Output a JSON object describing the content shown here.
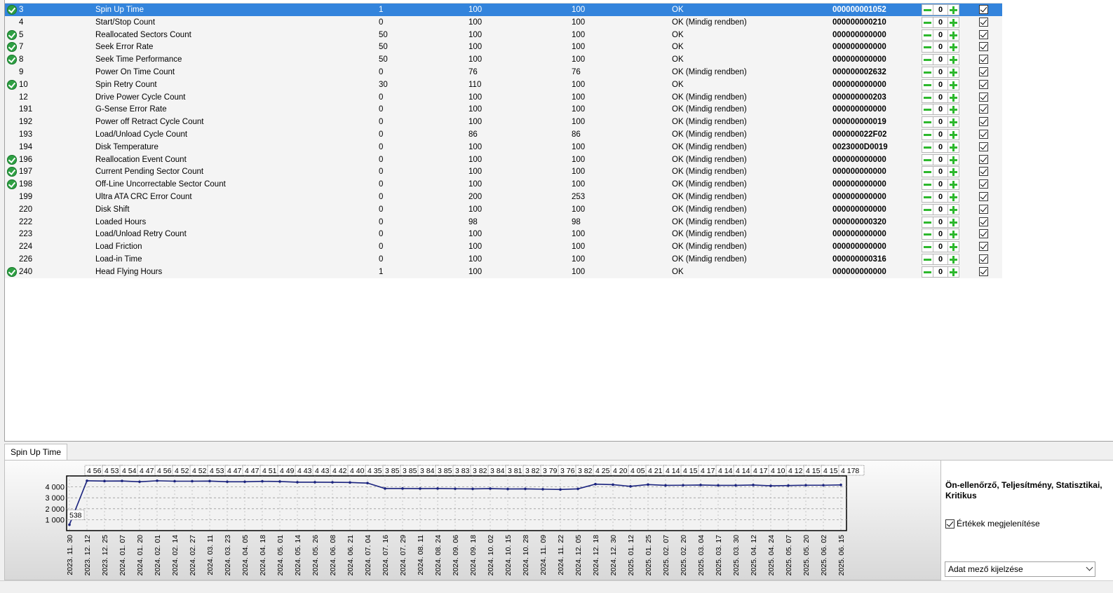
{
  "table": {
    "rows": [
      {
        "id": "3",
        "name": "Spin Up Time",
        "threshold": "1",
        "value": "100",
        "worst": "100",
        "status": "OK",
        "raw": "000000001052",
        "critical": true,
        "selected": true,
        "stepper": "0"
      },
      {
        "id": "4",
        "name": "Start/Stop Count",
        "threshold": "0",
        "value": "100",
        "worst": "100",
        "status": "OK (Mindig rendben)",
        "raw": "000000000210",
        "critical": false,
        "stepper": "0"
      },
      {
        "id": "5",
        "name": "Reallocated Sectors Count",
        "threshold": "50",
        "value": "100",
        "worst": "100",
        "status": "OK",
        "raw": "000000000000",
        "critical": true,
        "stepper": "0"
      },
      {
        "id": "7",
        "name": "Seek Error Rate",
        "threshold": "50",
        "value": "100",
        "worst": "100",
        "status": "OK",
        "raw": "000000000000",
        "critical": true,
        "stepper": "0"
      },
      {
        "id": "8",
        "name": "Seek Time Performance",
        "threshold": "50",
        "value": "100",
        "worst": "100",
        "status": "OK",
        "raw": "000000000000",
        "critical": true,
        "stepper": "0"
      },
      {
        "id": "9",
        "name": "Power On Time Count",
        "threshold": "0",
        "value": "76",
        "worst": "76",
        "status": "OK (Mindig rendben)",
        "raw": "000000002632",
        "critical": false,
        "stepper": "0"
      },
      {
        "id": "10",
        "name": "Spin Retry Count",
        "threshold": "30",
        "value": "110",
        "worst": "100",
        "status": "OK",
        "raw": "000000000000",
        "critical": true,
        "stepper": "0"
      },
      {
        "id": "12",
        "name": "Drive Power Cycle Count",
        "threshold": "0",
        "value": "100",
        "worst": "100",
        "status": "OK (Mindig rendben)",
        "raw": "000000000203",
        "critical": false,
        "stepper": "0"
      },
      {
        "id": "191",
        "name": "G-Sense Error Rate",
        "threshold": "0",
        "value": "100",
        "worst": "100",
        "status": "OK (Mindig rendben)",
        "raw": "000000000000",
        "critical": false,
        "stepper": "0"
      },
      {
        "id": "192",
        "name": "Power off Retract Cycle Count",
        "threshold": "0",
        "value": "100",
        "worst": "100",
        "status": "OK (Mindig rendben)",
        "raw": "000000000019",
        "critical": false,
        "stepper": "0"
      },
      {
        "id": "193",
        "name": "Load/Unload Cycle Count",
        "threshold": "0",
        "value": "86",
        "worst": "86",
        "status": "OK (Mindig rendben)",
        "raw": "000000022F02",
        "critical": false,
        "stepper": "0"
      },
      {
        "id": "194",
        "name": "Disk Temperature",
        "threshold": "0",
        "value": "100",
        "worst": "100",
        "status": "OK (Mindig rendben)",
        "raw": "0023000D0019",
        "critical": false,
        "stepper": "0"
      },
      {
        "id": "196",
        "name": "Reallocation Event Count",
        "threshold": "0",
        "value": "100",
        "worst": "100",
        "status": "OK (Mindig rendben)",
        "raw": "000000000000",
        "critical": true,
        "stepper": "0"
      },
      {
        "id": "197",
        "name": "Current Pending Sector Count",
        "threshold": "0",
        "value": "100",
        "worst": "100",
        "status": "OK (Mindig rendben)",
        "raw": "000000000000",
        "critical": true,
        "stepper": "0"
      },
      {
        "id": "198",
        "name": "Off-Line Uncorrectable Sector Count",
        "threshold": "0",
        "value": "100",
        "worst": "100",
        "status": "OK (Mindig rendben)",
        "raw": "000000000000",
        "critical": true,
        "stepper": "0"
      },
      {
        "id": "199",
        "name": "Ultra ATA CRC Error Count",
        "threshold": "0",
        "value": "200",
        "worst": "253",
        "status": "OK (Mindig rendben)",
        "raw": "000000000000",
        "critical": false,
        "stepper": "0"
      },
      {
        "id": "220",
        "name": "Disk Shift",
        "threshold": "0",
        "value": "100",
        "worst": "100",
        "status": "OK (Mindig rendben)",
        "raw": "000000000000",
        "critical": false,
        "stepper": "0"
      },
      {
        "id": "222",
        "name": "Loaded Hours",
        "threshold": "0",
        "value": "98",
        "worst": "98",
        "status": "OK (Mindig rendben)",
        "raw": "000000000320",
        "critical": false,
        "stepper": "0"
      },
      {
        "id": "223",
        "name": "Load/Unload Retry Count",
        "threshold": "0",
        "value": "100",
        "worst": "100",
        "status": "OK (Mindig rendben)",
        "raw": "000000000000",
        "critical": false,
        "stepper": "0"
      },
      {
        "id": "224",
        "name": "Load Friction",
        "threshold": "0",
        "value": "100",
        "worst": "100",
        "status": "OK (Mindig rendben)",
        "raw": "000000000000",
        "critical": false,
        "stepper": "0"
      },
      {
        "id": "226",
        "name": "Load-in Time",
        "threshold": "0",
        "value": "100",
        "worst": "100",
        "status": "OK (Mindig rendben)",
        "raw": "000000000316",
        "critical": false,
        "stepper": "0"
      },
      {
        "id": "240",
        "name": "Head Flying Hours",
        "threshold": "1",
        "value": "100",
        "worst": "100",
        "status": "OK",
        "raw": "000000000000",
        "critical": true,
        "stepper": "0"
      }
    ]
  },
  "tabs": [
    {
      "label": "Spin Up Time",
      "active": true
    }
  ],
  "side_panel": {
    "title": "Ön-ellenőrző, Teljesítmény, Statisztikai, Kritikus",
    "show_values_label": "Értékek megjelenítése",
    "show_values_checked": true,
    "select_value": "Adat mező kijelzése"
  },
  "colors": {
    "selection": "#3384dc",
    "ok_green": "#2ea043",
    "line": "#1a237e"
  },
  "chart_data": {
    "type": "line",
    "title": "",
    "xlabel": "",
    "ylabel": "",
    "ylim": [
      0,
      5000
    ],
    "yticks": [
      "1 000",
      "2 000",
      "3 000",
      "4 000"
    ],
    "grid": true,
    "x": [
      "2023. 11. 30",
      "2023. 12. 12",
      "2023. 12. 25",
      "2024. 01. 07",
      "2024. 01. 20",
      "2024. 02. 01",
      "2024. 02. 14",
      "2024. 02. 27",
      "2024. 03. 11",
      "2024. 03. 23",
      "2024. 04. 05",
      "2024. 04. 18",
      "2024. 05. 01",
      "2024. 05. 14",
      "2024. 05. 26",
      "2024. 06. 08",
      "2024. 06. 21",
      "2024. 07. 04",
      "2024. 07. 16",
      "2024. 07. 29",
      "2024. 08. 11",
      "2024. 08. 24",
      "2024. 09. 06",
      "2024. 09. 18",
      "2024. 10. 02",
      "2024. 10. 15",
      "2024. 10. 28",
      "2024. 11. 09",
      "2024. 11. 22",
      "2024. 12. 05",
      "2024. 12. 18",
      "2024. 12. 30",
      "2025. 01. 12",
      "2025. 01. 25",
      "2025. 02. 07",
      "2025. 02. 20",
      "2025. 03. 04",
      "2025. 03. 17",
      "2025. 03. 30",
      "2025. 04. 12",
      "2025. 04. 24",
      "2025. 05. 07",
      "2025. 05. 20",
      "2025. 06. 02",
      "2025. 06. 15"
    ],
    "series": [
      {
        "values": [
          538,
          4560,
          4530,
          4540,
          4470,
          4560,
          4520,
          4520,
          4530,
          4470,
          4470,
          4510,
          4490,
          4430,
          4430,
          4420,
          4400,
          4350,
          3850,
          3850,
          3840,
          3850,
          3830,
          3820,
          3840,
          3810,
          3820,
          3790,
          3760,
          3820,
          4250,
          4200,
          4050,
          4210,
          4140,
          4150,
          4170,
          4140,
          4140,
          4170,
          4100,
          4120,
          4150,
          4150,
          4178
        ],
        "labels": [
          "538",
          "4 56",
          "4 53",
          "4 54",
          "4 47",
          "4 56",
          "4 52",
          "4 52",
          "4 53",
          "4 47",
          "4 47",
          "4 51",
          "4 49",
          "4 43",
          "4 43",
          "4 42",
          "4 40",
          "4 35",
          "3 85",
          "3 85",
          "3 84",
          "3 85",
          "3 83",
          "3 82",
          "3 84",
          "3 81",
          "3 82",
          "3 79",
          "3 76",
          "3 82",
          "4 25",
          "4 20",
          "4 05",
          "4 21",
          "4 14",
          "4 15",
          "4 17",
          "4 14",
          "4 14",
          "4 17",
          "4 10",
          "4 12",
          "4 15",
          "4 15",
          "4 178"
        ]
      }
    ]
  }
}
